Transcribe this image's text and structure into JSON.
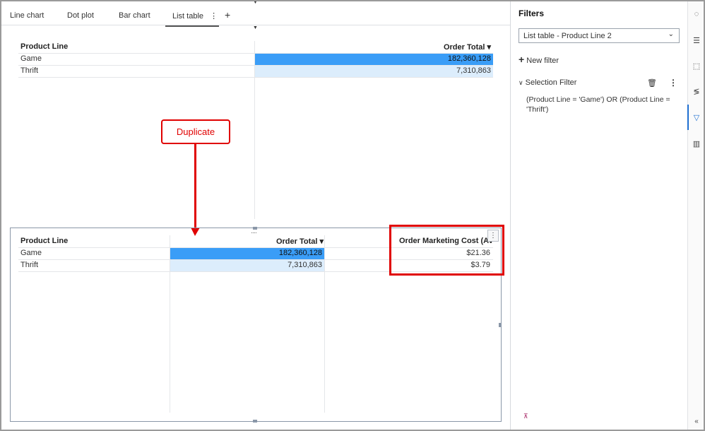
{
  "tabs": [
    {
      "label": "Line chart"
    },
    {
      "label": "Dot plot"
    },
    {
      "label": "Bar chart"
    },
    {
      "label": "List table",
      "active": true
    }
  ],
  "add_tab": "+",
  "table1": {
    "headers": [
      "Product Line",
      "Order Total ▾"
    ],
    "rows": [
      {
        "product": "Game",
        "total": "182,360,128",
        "fraction": 1.0
      },
      {
        "product": "Thrift",
        "total": "7,310,863",
        "fraction": 0.04
      }
    ]
  },
  "table2": {
    "headers": [
      "Product Line",
      "Order Total ▾",
      "Order Marketing Cost (Avg."
    ],
    "rows": [
      {
        "product": "Game",
        "total": "182,360,128",
        "cost": "$21.36"
      },
      {
        "product": "Thrift",
        "total": "7,310,863",
        "cost": "$3.79"
      }
    ]
  },
  "callout": {
    "label": "Duplicate"
  },
  "filters": {
    "title": "Filters",
    "selected_object": "List table - Product Line 2",
    "new_filter": "New filter",
    "filter_name": "Selection Filter",
    "expression": "(Product Line = 'Game') OR (Product Line = 'Thrift')"
  },
  "colors": {
    "bar_strong": "#3a9df7",
    "bar_light": "#dcedfc",
    "callout": "#e00000",
    "accent": "#1f6fd1"
  }
}
